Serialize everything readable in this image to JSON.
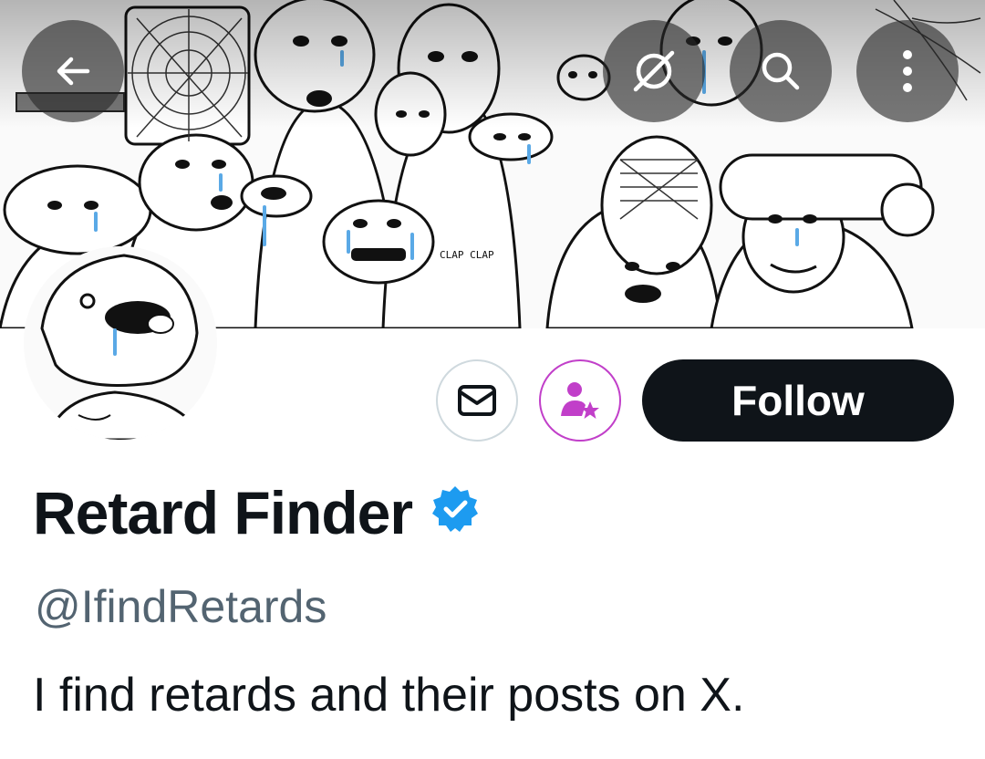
{
  "header": {
    "back_icon": "arrow-left-icon",
    "translate_icon": "grok-slash-icon",
    "search_icon": "search-icon",
    "more_icon": "more-vertical-icon"
  },
  "banner": {
    "caption": "CLAP CLAP"
  },
  "profile": {
    "display_name": "Retard Finder",
    "handle": "@IfindRetards",
    "bio": "I find retards and their posts on X.",
    "verified": true
  },
  "actions": {
    "message_icon": "mail-icon",
    "subscribe_icon": "person-star-icon",
    "follow_label": "Follow"
  },
  "colors": {
    "verified_badge": "#1d9bf0",
    "subscribe_accent": "#c13fc9",
    "follow_bg": "#0f1419",
    "handle_text": "#536471"
  }
}
